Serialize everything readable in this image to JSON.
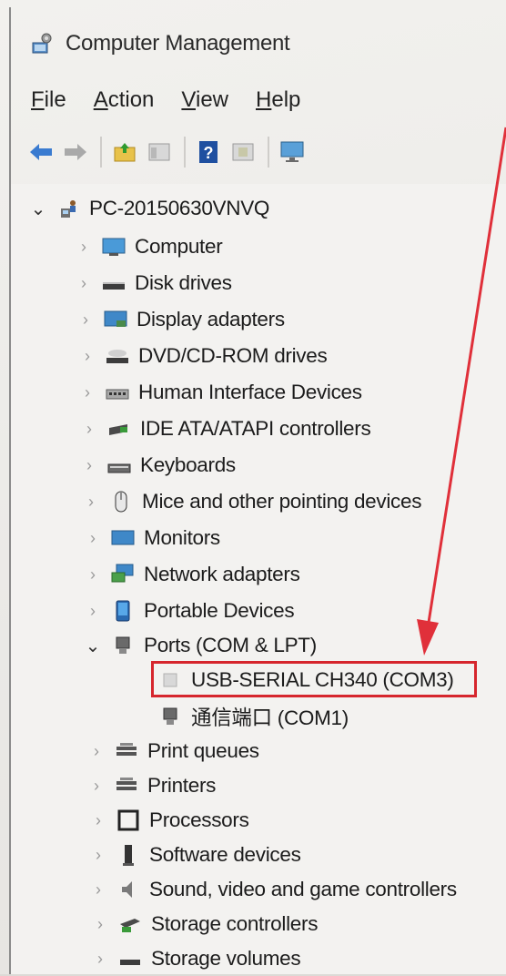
{
  "window": {
    "title": "Computer Management"
  },
  "menu": [
    {
      "label": "File",
      "key": "F",
      "rest": "ile"
    },
    {
      "label": "Action",
      "key": "A",
      "rest": "ction"
    },
    {
      "label": "View",
      "key": "V",
      "rest": "iew"
    },
    {
      "label": "Help",
      "key": "H",
      "rest": "elp"
    }
  ],
  "toolbar": [
    "back-icon",
    "forward-icon",
    "up-folder-icon",
    "show-hide-tree-icon",
    "help-icon",
    "export-list-icon",
    "monitor-icon"
  ],
  "tree": {
    "root": "PC-20150630VNVQ",
    "items": [
      {
        "label": "Computer",
        "icon": "computer-icon"
      },
      {
        "label": "Disk drives",
        "icon": "disk-drive-icon"
      },
      {
        "label": "Display adapters",
        "icon": "display-adapter-icon"
      },
      {
        "label": "DVD/CD-ROM drives",
        "icon": "dvd-drive-icon"
      },
      {
        "label": "Human Interface Devices",
        "icon": "hid-icon"
      },
      {
        "label": "IDE ATA/ATAPI controllers",
        "icon": "ide-controller-icon"
      },
      {
        "label": "Keyboards",
        "icon": "keyboard-icon"
      },
      {
        "label": "Mice and other pointing devices",
        "icon": "mouse-icon"
      },
      {
        "label": "Monitors",
        "icon": "monitor-icon"
      },
      {
        "label": "Network adapters",
        "icon": "network-adapter-icon"
      },
      {
        "label": "Portable Devices",
        "icon": "portable-device-icon"
      },
      {
        "label": "Ports (COM & LPT)",
        "icon": "port-icon",
        "expanded": true
      },
      {
        "label": "USB-SERIAL CH340 (COM3)",
        "icon": "usb-serial-icon",
        "child": true,
        "highlighted": true
      },
      {
        "label": "通信端口 (COM1)",
        "icon": "com-port-icon",
        "child": true
      },
      {
        "label": "Print queues",
        "icon": "print-queue-icon"
      },
      {
        "label": "Printers",
        "icon": "printer-icon"
      },
      {
        "label": "Processors",
        "icon": "processor-icon"
      },
      {
        "label": "Software devices",
        "icon": "software-device-icon"
      },
      {
        "label": "Sound, video and game controllers",
        "icon": "sound-icon"
      },
      {
        "label": "Storage controllers",
        "icon": "storage-controller-icon"
      },
      {
        "label": "Storage volumes",
        "icon": "storage-volume-icon"
      }
    ]
  },
  "colors": {
    "highlight": "#d6262d",
    "arrow": "#e0303a"
  }
}
